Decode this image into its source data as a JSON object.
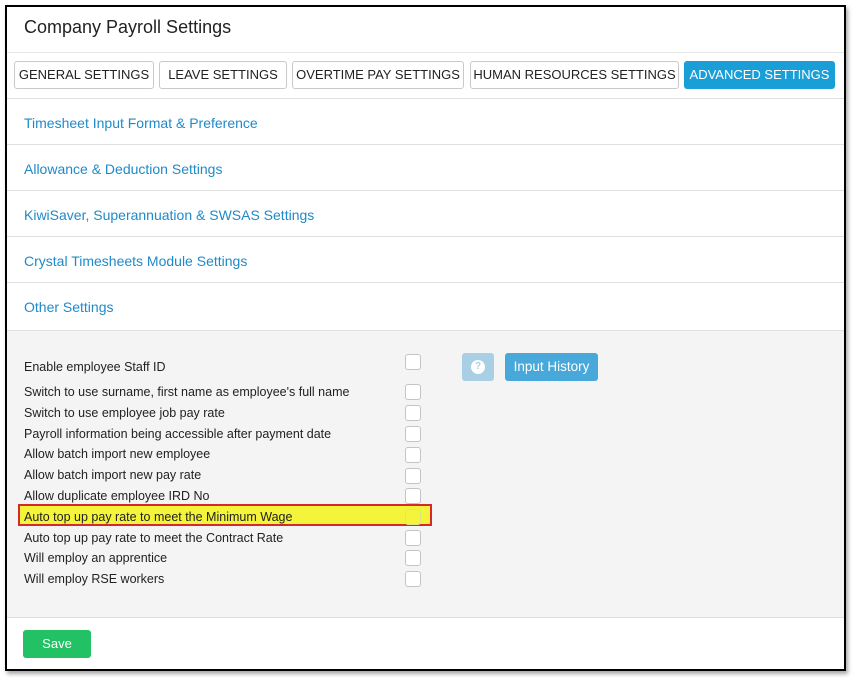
{
  "header": {
    "title": "Company Payroll Settings"
  },
  "tabs": [
    {
      "label": "GENERAL SETTINGS",
      "active": false
    },
    {
      "label": "LEAVE SETTINGS",
      "active": false
    },
    {
      "label": "OVERTIME PAY SETTINGS",
      "active": false
    },
    {
      "label": "HUMAN RESOURCES SETTINGS",
      "active": false
    },
    {
      "label": "ADVANCED SETTINGS",
      "active": true
    }
  ],
  "sections": [
    {
      "title": "Timesheet Input Format & Preference"
    },
    {
      "title": "Allowance & Deduction Settings"
    },
    {
      "title": "KiwiSaver, Superannuation & SWSAS Settings"
    },
    {
      "title": "Crystal Timesheets Module Settings"
    },
    {
      "title": "Other Settings"
    }
  ],
  "other_settings": {
    "help_icon": "question-circle-icon",
    "input_history_label": "Input History",
    "options": [
      {
        "label": "Enable employee Staff ID",
        "checked": false
      },
      {
        "label": "Switch to use surname, first name as employee's full name",
        "checked": false
      },
      {
        "label": "Switch to use employee job pay rate",
        "checked": false
      },
      {
        "label": "Payroll information being accessible after payment date",
        "checked": false
      },
      {
        "label": "Allow batch import new employee",
        "checked": false
      },
      {
        "label": "Allow batch import new pay rate",
        "checked": false
      },
      {
        "label": "Allow duplicate employee IRD No",
        "checked": false
      },
      {
        "label": "Auto top up pay rate to meet the Minimum Wage",
        "checked": false,
        "highlighted": true
      },
      {
        "label": "Auto top up pay rate to meet the Contract Rate",
        "checked": false
      },
      {
        "label": "Will employ an apprentice",
        "checked": false
      },
      {
        "label": "Will employ RSE workers",
        "checked": false
      }
    ]
  },
  "footer": {
    "save_label": "Save"
  },
  "colors": {
    "accent": "#1a9ed8",
    "link": "#1f8ac9",
    "save": "#22c164",
    "highlight": "#f4f43a",
    "highlight_border": "#d62a2a"
  }
}
